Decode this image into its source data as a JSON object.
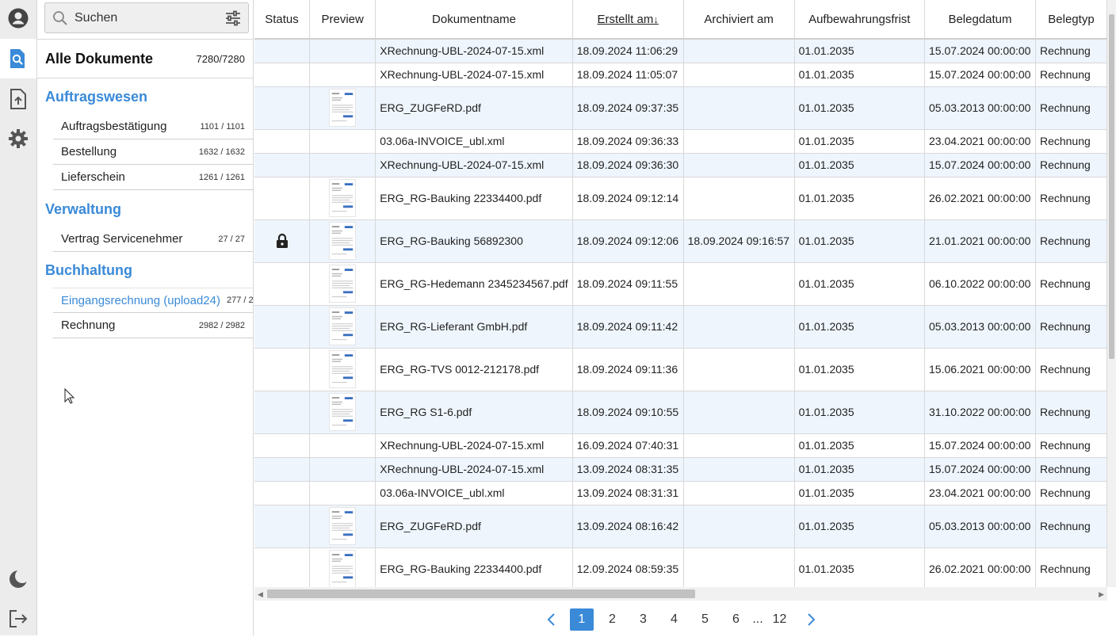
{
  "rail": {
    "icons": [
      "user-icon",
      "search-docs-icon",
      "upload-icon",
      "gear-icon",
      "moon-icon",
      "logout-icon"
    ]
  },
  "search": {
    "placeholder": "Suchen"
  },
  "all_docs": {
    "label": "Alle Dokumente",
    "count": "7280/7280"
  },
  "groups": [
    {
      "title": "Auftragswesen",
      "items": [
        {
          "label": "Auftragsbestätigung",
          "count": "1101 / 1101"
        },
        {
          "label": "Bestellung",
          "count": "1632 / 1632"
        },
        {
          "label": "Lieferschein",
          "count": "1261 / 1261"
        }
      ]
    },
    {
      "title": "Verwaltung",
      "items": [
        {
          "label": "Vertrag Servicenehmer",
          "count": "27 / 27"
        }
      ]
    },
    {
      "title": "Buchhaltung",
      "items": [
        {
          "label": "Eingangsrechnung (upload24)",
          "count": "277 / 2"
        },
        {
          "label": "Rechnung",
          "count": "2982 / 2982"
        }
      ]
    }
  ],
  "columns": [
    "Status",
    "Preview",
    "Dokumentname",
    "Erstellt am",
    "Archiviert am",
    "Aufbewahrungsfrist",
    "Belegdatum",
    "Belegtyp"
  ],
  "rows": [
    {
      "name": "XRechnung-UBL-2024-07-15.xml",
      "created": "18.09.2024 11:06:29",
      "archived": "",
      "retention": "01.01.2035",
      "docdate": "15.07.2024 00:00:00",
      "type": "Rechnung",
      "preview": false,
      "locked": false
    },
    {
      "name": "XRechnung-UBL-2024-07-15.xml",
      "created": "18.09.2024 11:05:07",
      "archived": "",
      "retention": "01.01.2035",
      "docdate": "15.07.2024 00:00:00",
      "type": "Rechnung",
      "preview": false,
      "locked": false
    },
    {
      "name": "ERG_ZUGFeRD.pdf",
      "created": "18.09.2024 09:37:35",
      "archived": "",
      "retention": "01.01.2035",
      "docdate": "05.03.2013 00:00:00",
      "type": "Rechnung",
      "preview": true,
      "locked": false
    },
    {
      "name": "03.06a-INVOICE_ubl.xml",
      "created": "18.09.2024 09:36:33",
      "archived": "",
      "retention": "01.01.2035",
      "docdate": "23.04.2021 00:00:00",
      "type": "Rechnung",
      "preview": false,
      "locked": false
    },
    {
      "name": "XRechnung-UBL-2024-07-15.xml",
      "created": "18.09.2024 09:36:30",
      "archived": "",
      "retention": "01.01.2035",
      "docdate": "15.07.2024 00:00:00",
      "type": "Rechnung",
      "preview": false,
      "locked": false
    },
    {
      "name": "ERG_RG-Bauking 22334400.pdf",
      "created": "18.09.2024 09:12:14",
      "archived": "",
      "retention": "01.01.2035",
      "docdate": "26.02.2021 00:00:00",
      "type": "Rechnung",
      "preview": true,
      "locked": false
    },
    {
      "name": "ERG_RG-Bauking 56892300",
      "created": "18.09.2024 09:12:06",
      "archived": "18.09.2024 09:16:57",
      "retention": "01.01.2035",
      "docdate": "21.01.2021 00:00:00",
      "type": "Rechnung",
      "preview": true,
      "locked": true
    },
    {
      "name": "ERG_RG-Hedemann 2345234567.pdf",
      "created": "18.09.2024 09:11:55",
      "archived": "",
      "retention": "01.01.2035",
      "docdate": "06.10.2022 00:00:00",
      "type": "Rechnung",
      "preview": true,
      "locked": false
    },
    {
      "name": "ERG_RG-Lieferant GmbH.pdf",
      "created": "18.09.2024 09:11:42",
      "archived": "",
      "retention": "01.01.2035",
      "docdate": "05.03.2013 00:00:00",
      "type": "Rechnung",
      "preview": true,
      "locked": false
    },
    {
      "name": "ERG_RG-TVS 0012-212178.pdf",
      "created": "18.09.2024 09:11:36",
      "archived": "",
      "retention": "01.01.2035",
      "docdate": "15.06.2021 00:00:00",
      "type": "Rechnung",
      "preview": true,
      "locked": false
    },
    {
      "name": "ERG_RG S1-6.pdf",
      "created": "18.09.2024 09:10:55",
      "archived": "",
      "retention": "01.01.2035",
      "docdate": "31.10.2022 00:00:00",
      "type": "Rechnung",
      "preview": true,
      "locked": false
    },
    {
      "name": "XRechnung-UBL-2024-07-15.xml",
      "created": "16.09.2024 07:40:31",
      "archived": "",
      "retention": "01.01.2035",
      "docdate": "15.07.2024 00:00:00",
      "type": "Rechnung",
      "preview": false,
      "locked": false
    },
    {
      "name": "XRechnung-UBL-2024-07-15.xml",
      "created": "13.09.2024 08:31:35",
      "archived": "",
      "retention": "01.01.2035",
      "docdate": "15.07.2024 00:00:00",
      "type": "Rechnung",
      "preview": false,
      "locked": false
    },
    {
      "name": "03.06a-INVOICE_ubl.xml",
      "created": "13.09.2024 08:31:31",
      "archived": "",
      "retention": "01.01.2035",
      "docdate": "23.04.2021 00:00:00",
      "type": "Rechnung",
      "preview": false,
      "locked": false
    },
    {
      "name": "ERG_ZUGFeRD.pdf",
      "created": "13.09.2024 08:16:42",
      "archived": "",
      "retention": "01.01.2035",
      "docdate": "05.03.2013 00:00:00",
      "type": "Rechnung",
      "preview": true,
      "locked": false
    },
    {
      "name": "ERG_RG-Bauking 22334400.pdf",
      "created": "12.09.2024 08:59:35",
      "archived": "",
      "retention": "01.01.2035",
      "docdate": "26.02.2021 00:00:00",
      "type": "Rechnung",
      "preview": true,
      "locked": false
    }
  ],
  "pagination": {
    "pages": [
      "1",
      "2",
      "3",
      "4",
      "5",
      "6"
    ],
    "ellipsis": "...",
    "last": "12",
    "current": "1"
  },
  "colors": {
    "accent": "#3a8ad8",
    "row_alt": "#eef5fd"
  }
}
